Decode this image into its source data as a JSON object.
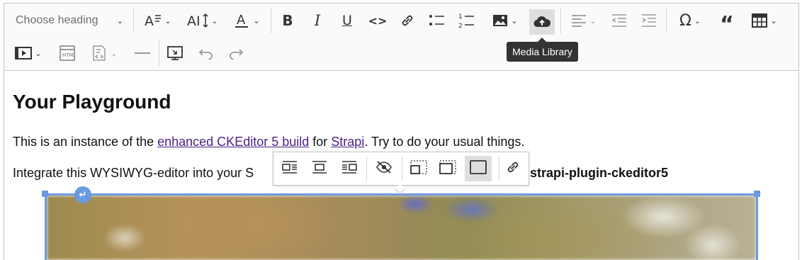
{
  "toolbar": {
    "heading_placeholder": "Choose heading",
    "tooltip": "Media Library"
  },
  "content": {
    "title": "Your Playground",
    "p1_before": "This is an instance of the ",
    "p1_link1": "enhanced CKEditor 5 build",
    "p1_mid": " for ",
    "p1_link2": "Strapi",
    "p1_after": ". Try to do your usual things.",
    "p2_before": "Integrate this WYSIWYG-editor into your S",
    "p2_bold": "strapi-plugin-ckeditor5"
  },
  "colors": {
    "accent": "#6c9ae0",
    "link": "#4b1f86",
    "tooltip_bg": "#333333"
  },
  "icons": {
    "toolbar": [
      "font-size-icon",
      "font-family-icon",
      "font-color-icon",
      "bold-icon",
      "italic-icon",
      "underline-icon",
      "code-icon",
      "link-icon",
      "bulleted-list-icon",
      "numbered-list-icon",
      "image-icon",
      "media-library-icon",
      "align-icon",
      "outdent-icon",
      "indent-icon",
      "special-characters-icon",
      "quote-icon",
      "table-icon",
      "media-embed-icon",
      "html-embed-icon",
      "source-editing-icon",
      "horizontal-line-icon",
      "fullscreen-icon",
      "undo-icon",
      "redo-icon"
    ],
    "image_balloon": [
      "wrap-text-left-icon",
      "centered-image-icon",
      "wrap-text-right-icon",
      "toggle-caption-icon",
      "resize-small-icon",
      "resize-medium-icon",
      "resize-original-icon",
      "link-image-icon"
    ]
  }
}
